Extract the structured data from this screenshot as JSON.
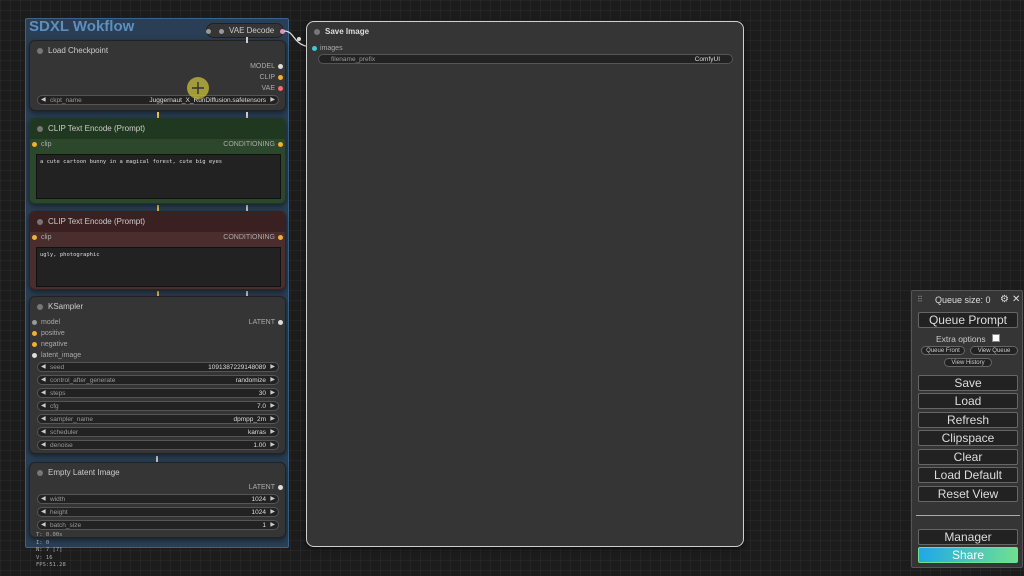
{
  "group": {
    "title": "SDXL Wokflow"
  },
  "vae_decode": {
    "title": "VAE Decode"
  },
  "load_checkpoint": {
    "title": "Load Checkpoint",
    "outputs": [
      "MODEL",
      "CLIP",
      "VAE"
    ],
    "ckpt_label": "ckpt_name",
    "ckpt_value": "Juggernaut_X_RunDiffusion.safetensors"
  },
  "clip_pos": {
    "title": "CLIP Text Encode (Prompt)",
    "input": "clip",
    "output": "CONDITIONING",
    "text": "a cute cartoon bunny in a magical forest, cute big eyes"
  },
  "clip_neg": {
    "title": "CLIP Text Encode (Prompt)",
    "input": "clip",
    "output": "CONDITIONING",
    "text": "ugly, photographic"
  },
  "ksampler": {
    "title": "KSampler",
    "inputs": [
      "model",
      "positive",
      "negative",
      "latent_image"
    ],
    "output": "LATENT",
    "widgets": [
      {
        "label": "seed",
        "value": "1091387229148089"
      },
      {
        "label": "control_after_generate",
        "value": "randomize"
      },
      {
        "label": "steps",
        "value": "30"
      },
      {
        "label": "cfg",
        "value": "7.0"
      },
      {
        "label": "sampler_name",
        "value": "dpmpp_2m"
      },
      {
        "label": "scheduler",
        "value": "karras"
      },
      {
        "label": "denoise",
        "value": "1.00"
      }
    ]
  },
  "empty_latent": {
    "title": "Empty Latent Image",
    "output": "LATENT",
    "widgets": [
      {
        "label": "width",
        "value": "1024"
      },
      {
        "label": "height",
        "value": "1024"
      },
      {
        "label": "batch_size",
        "value": "1"
      }
    ]
  },
  "save_image": {
    "title": "Save Image",
    "input": "images",
    "prefix_label": "filename_prefix",
    "prefix_value": "ComfyUI"
  },
  "queue": {
    "size_label": "Queue size: 0",
    "queue_prompt": "Queue Prompt",
    "extra_options": "Extra options",
    "queue_front": "Queue Front",
    "view_queue": "View Queue",
    "view_history": "View History",
    "save": "Save",
    "load": "Load",
    "refresh": "Refresh",
    "clipspace": "Clipspace",
    "clear": "Clear",
    "load_default": "Load Default",
    "reset_view": "Reset View",
    "manager": "Manager",
    "share": "Share"
  },
  "stats": {
    "t": "T: 0.00s",
    "i": "I: 0",
    "n": "N: 7 [7]",
    "v": "V: 16",
    "fps": "FPS:51.28"
  },
  "colors": {
    "group_bg": "#2a3f55",
    "positive_node": "#2f5a2f",
    "negative_node": "#5a2f2f",
    "share_gradient_start": "#1fa8e8",
    "share_gradient_end": "#6fe090"
  }
}
